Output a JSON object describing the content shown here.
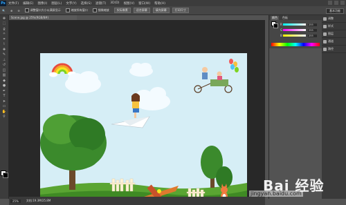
{
  "app": {
    "logo": "Ps"
  },
  "menubar": {
    "items": [
      "文件(F)",
      "编辑(E)",
      "图像(I)",
      "图层(L)",
      "文字(Y)",
      "选择(S)",
      "滤镜(T)",
      "3D(D)",
      "视图(V)",
      "窗口(W)",
      "帮助(H)"
    ]
  },
  "options": {
    "items": [
      "调整窗口大小以满屏显示",
      "缩放所有窗口",
      "细微缩放"
    ],
    "buttons": [
      "实际像素",
      "适合屏幕",
      "填充屏幕",
      "打印尺寸"
    ],
    "workspace": "基本功能"
  },
  "document": {
    "tab": "Scene.jpg @ 25%(RGB/8#)"
  },
  "status": {
    "zoom": "25%",
    "doc": "文档:19.3M/25.8M"
  },
  "color_panel": {
    "tabs": [
      "颜色",
      "色板"
    ],
    "channels": [
      {
        "label": "R",
        "value": "255"
      },
      {
        "label": "G",
        "value": "255"
      },
      {
        "label": "B",
        "value": "255"
      }
    ]
  },
  "iconstrip": {
    "items": [
      "调整",
      "样式",
      "图层",
      "通道",
      "路径"
    ]
  },
  "watermark": {
    "logo": "Bai 经验",
    "url": "jingyan.baidu.com"
  },
  "colors": {
    "canvas_bg": "#d6eef6",
    "grass": "#4f9a2c",
    "tree": "#2f7a25",
    "sky": "#d6eef6"
  },
  "tools": [
    "move-icon",
    "marquee-icon",
    "lasso-icon",
    "magic-wand-icon",
    "crop-icon",
    "eyedropper-icon",
    "healing-icon",
    "brush-icon",
    "stamp-icon",
    "history-brush-icon",
    "eraser-icon",
    "gradient-icon",
    "blur-icon",
    "dodge-icon",
    "pen-icon",
    "type-icon",
    "path-select-icon",
    "shape-icon",
    "hand-icon",
    "zoom-icon"
  ]
}
